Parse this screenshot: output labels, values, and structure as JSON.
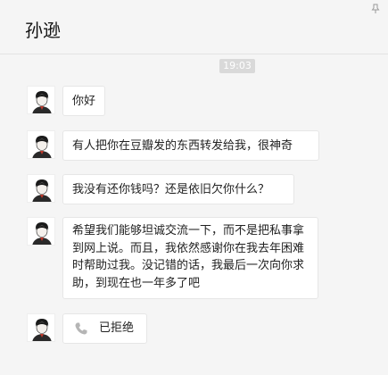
{
  "header": {
    "title": "孙逊",
    "pin_icon": "pin-icon"
  },
  "chat": {
    "timestamp": "19:03",
    "messages": [
      {
        "text": "你好",
        "avatar": "avatar"
      },
      {
        "text": "有人把你在豆瓣发的东西转发给我，很神奇",
        "avatar": "avatar"
      },
      {
        "text": "我没有还你钱吗？还是依旧欠你什么？",
        "avatar": "avatar"
      },
      {
        "text": "希望我们能够坦诚交流一下，而不是把私事拿到网上说。而且，我依然感谢你在我去年困难时帮助过我。没记错的话，我最后一次向你求助，到现在也一年多了吧",
        "avatar": "avatar"
      }
    ],
    "call": {
      "label": "已拒绝",
      "icon": "phone-icon"
    }
  },
  "colors": {
    "background": "#f5f5f5",
    "bubble": "#ffffff",
    "timestamp_bg": "#d9d9d9"
  }
}
